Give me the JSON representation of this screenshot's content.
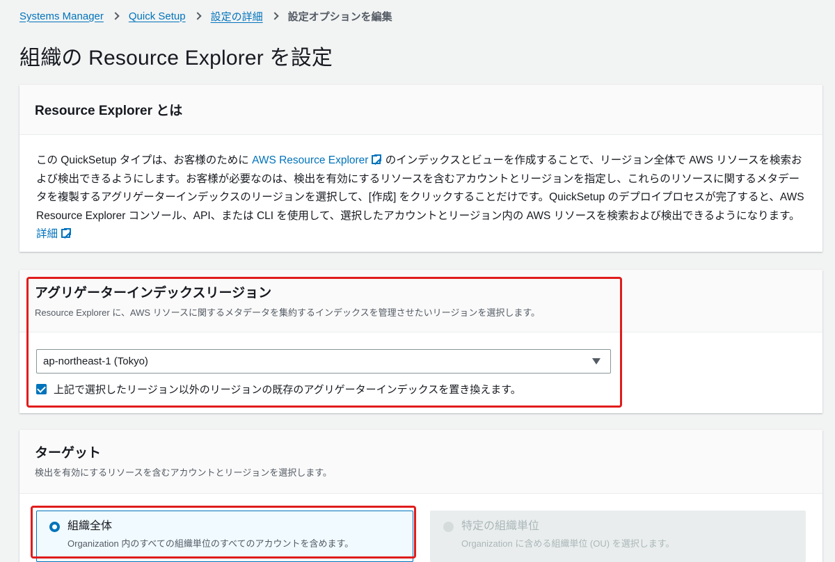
{
  "breadcrumb": {
    "items": [
      "Systems Manager",
      "Quick Setup",
      "設定の詳細"
    ],
    "current": "設定オプションを編集"
  },
  "page_title": "組織の Resource Explorer を設定",
  "about": {
    "title": "Resource Explorer とは",
    "text_1": "この QuickSetup タイプは、お客様のために",
    "link_1": "AWS Resource Explorer",
    "text_2": "のインデックスとビューを作成することで、リージョン全体で AWS リソースを検索および検出できるようにします。お客様が必要なのは、検出を有効にするリソースを含むアカウントとリージョンを指定し、これらのリソースに関するメタデータを複製するアグリゲーターインデックスのリージョンを選択して、[作成] をクリックすることだけです。QuickSetup のデプロイプロセスが完了すると、AWS Resource Explorer コンソール、API、または CLI を使用して、選択したアカウントとリージョン内の AWS リソースを検索および検出できるようになります。",
    "link_2": "詳細"
  },
  "aggregator": {
    "title": "アグリゲーターインデックスリージョン",
    "description": "Resource Explorer に、AWS リソースに関するメタデータを集約するインデックスを管理させたいリージョンを選択します。",
    "selected_region": "ap-northeast-1 (Tokyo)",
    "checkbox_label": "上記で選択したリージョン以外のリージョンの既存のアグリゲーターインデックスを置き換えます。",
    "checkbox_checked": true
  },
  "target": {
    "title": "ターゲット",
    "description": "検出を有効にするリソースを含むアカウントとリージョンを選択します。",
    "options": [
      {
        "title": "組織全体",
        "description": "Organization 内のすべての組織単位のすべてのアカウントを含めます。",
        "selected": true
      },
      {
        "title": "特定の組織単位",
        "description": "Organization に含める組織単位 (OU) を選択します。",
        "selected": false
      }
    ]
  },
  "colors": {
    "link": "#0073bb",
    "highlight": "#e01c1c",
    "background": "#f2f3f3"
  },
  "icons": [
    "external-link-icon",
    "chevron-right-icon",
    "caret-down-icon"
  ]
}
